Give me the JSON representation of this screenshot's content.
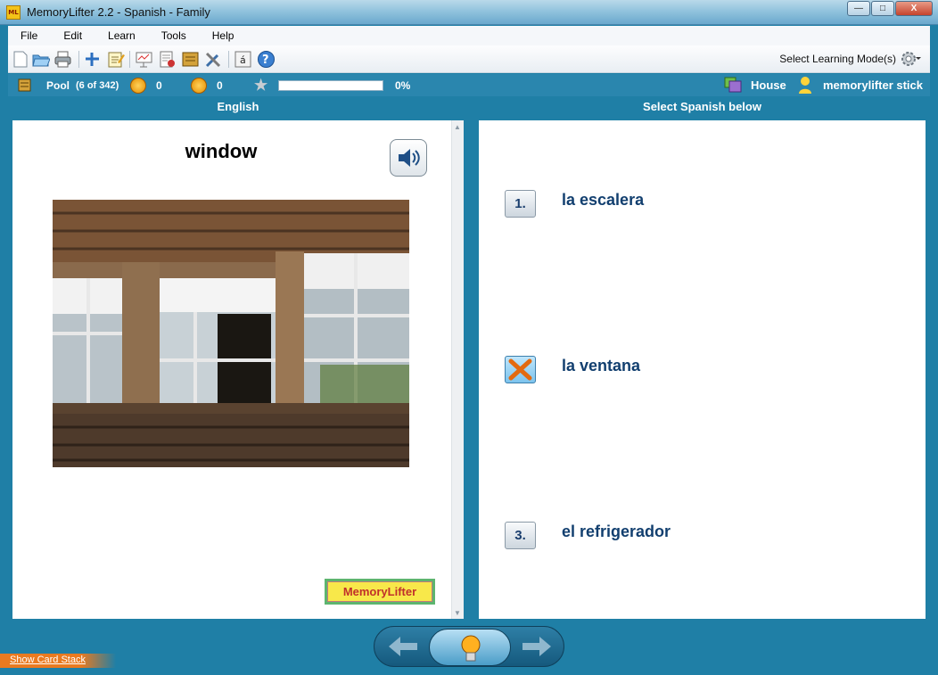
{
  "window": {
    "title": "MemoryLifter 2.2 - Spanish - Family",
    "app_icon_text": "ML",
    "min": "—",
    "max": "□",
    "close": "X"
  },
  "menu": [
    "File",
    "Edit",
    "Learn",
    "Tools",
    "Help"
  ],
  "toolbar": {
    "mode_label": "Select Learning Mode(s)"
  },
  "status": {
    "pool": "Pool",
    "count": "(6 of 342)",
    "happy": "0",
    "sad": "0",
    "progress_pct": 0,
    "progress_label": "0%",
    "chapter": "House",
    "user": "memorylifter stick"
  },
  "columns": {
    "left": "English",
    "right": "Select Spanish below"
  },
  "question": {
    "word": "window"
  },
  "answers": [
    {
      "marker": "1.",
      "text": "la escalera",
      "state": "normal"
    },
    {
      "marker": "X",
      "text": "la ventana",
      "state": "wrong"
    },
    {
      "marker": "3.",
      "text": "el refrigerador",
      "state": "normal"
    }
  ],
  "logo": {
    "text": "MemoryLifter"
  },
  "footer": {
    "show_stack": "Show Card Stack"
  },
  "colors": {
    "accent": "#1f7fa6",
    "answer_text": "#123f6f",
    "logo_bg": "#f8e84a"
  }
}
